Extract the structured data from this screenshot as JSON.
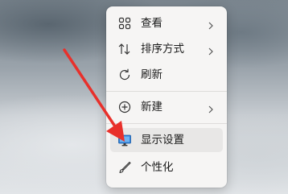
{
  "context_menu": {
    "items": [
      {
        "label": "查看",
        "icon": "grid-icon",
        "has_submenu": true
      },
      {
        "label": "排序方式",
        "icon": "sort-arrows-icon",
        "has_submenu": true
      },
      {
        "label": "刷新",
        "icon": "refresh-icon",
        "has_submenu": false
      },
      {
        "label": "新建",
        "icon": "new-plus-icon",
        "has_submenu": true
      },
      {
        "label": "显示设置",
        "icon": "display-settings-icon",
        "has_submenu": false,
        "highlighted": true
      },
      {
        "label": "个性化",
        "icon": "brush-icon",
        "has_submenu": false
      }
    ]
  },
  "annotation": {
    "arrow_color": "#e8302b"
  }
}
